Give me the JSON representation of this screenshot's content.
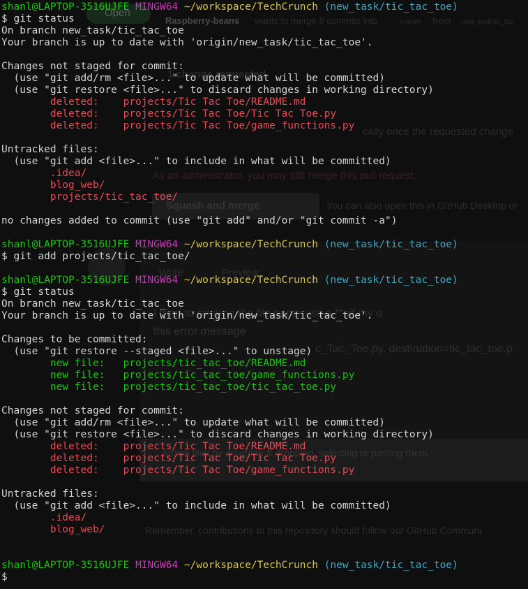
{
  "ghost": {
    "open_label": "Open",
    "repo_user": "Raspberry-beans",
    "merge_text": "wants to merge 8 commits into",
    "base_branch": "master",
    "from_label": "from",
    "head_branch": "new_task/tic_tac",
    "change_requested": "1 change requested",
    "dismiss_hint": "cally once the requested change",
    "admin_note": "As an administrator, you may still merge this pull request.",
    "squash_button": "Squash and merge",
    "desktop_note": "You can also open this in GitHub Desktop or",
    "write_tab": "Write",
    "preview_tab": "Preview",
    "comment_line1": "I tried to rename the file name using **git mv o",
    "comment_line2": "this error message",
    "comment_line3": "c_Tac_Toe.py, destination=tic_tac_toe.p",
    "attach_note": "Attach files by dragging & dropping, selecting or pasting them.",
    "contrib_note": "Remember, contributions to this repository should follow our GitHub Communi"
  },
  "terminal": {
    "lines": [
      [
        {
          "c": "c-prompt-user",
          "t": "shanl@LAPTOP-3516UJFE "
        },
        {
          "c": "c-prompt-sys",
          "t": "MINGW64 "
        },
        {
          "c": "c-prompt-path",
          "t": "~/workspace/TechCrunch "
        },
        {
          "c": "c-prompt-branch",
          "t": "(new_task/tic_tac_toe)"
        }
      ],
      [
        {
          "c": "c-default",
          "t": "$ git status"
        }
      ],
      [
        {
          "c": "c-default",
          "t": "On branch new_task/tic_tac_toe"
        }
      ],
      [
        {
          "c": "c-default",
          "t": "Your branch is up to date with 'origin/new_task/tic_tac_toe'."
        }
      ],
      [
        {
          "c": "c-default",
          "t": ""
        }
      ],
      [
        {
          "c": "c-default",
          "t": "Changes not staged for commit:"
        }
      ],
      [
        {
          "c": "c-default",
          "t": "  (use \"git add/rm <file>...\" to update what will be committed)"
        }
      ],
      [
        {
          "c": "c-default",
          "t": "  (use \"git restore <file>...\" to discard changes in working directory)"
        }
      ],
      [
        {
          "c": "c-red",
          "t": "        deleted:    projects/Tic Tac Toe/README.md"
        }
      ],
      [
        {
          "c": "c-red",
          "t": "        deleted:    projects/Tic Tac Toe/Tic Tac Toe.py"
        }
      ],
      [
        {
          "c": "c-red",
          "t": "        deleted:    projects/Tic Tac Toe/game_functions.py"
        }
      ],
      [
        {
          "c": "c-default",
          "t": ""
        }
      ],
      [
        {
          "c": "c-default",
          "t": "Untracked files:"
        }
      ],
      [
        {
          "c": "c-default",
          "t": "  (use \"git add <file>...\" to include in what will be committed)"
        }
      ],
      [
        {
          "c": "c-red",
          "t": "        .idea/"
        }
      ],
      [
        {
          "c": "c-red",
          "t": "        blog_web/"
        }
      ],
      [
        {
          "c": "c-red",
          "t": "        projects/tic_tac_toe/"
        }
      ],
      [
        {
          "c": "c-default",
          "t": ""
        }
      ],
      [
        {
          "c": "c-default",
          "t": "no changes added to commit (use \"git add\" and/or \"git commit -a\")"
        }
      ],
      [
        {
          "c": "c-default",
          "t": ""
        }
      ],
      [
        {
          "c": "c-prompt-user",
          "t": "shanl@LAPTOP-3516UJFE "
        },
        {
          "c": "c-prompt-sys",
          "t": "MINGW64 "
        },
        {
          "c": "c-prompt-path",
          "t": "~/workspace/TechCrunch "
        },
        {
          "c": "c-prompt-branch",
          "t": "(new_task/tic_tac_toe)"
        }
      ],
      [
        {
          "c": "c-default",
          "t": "$ git add projects/tic_tac_toe/"
        }
      ],
      [
        {
          "c": "c-default",
          "t": ""
        }
      ],
      [
        {
          "c": "c-prompt-user",
          "t": "shanl@LAPTOP-3516UJFE "
        },
        {
          "c": "c-prompt-sys",
          "t": "MINGW64 "
        },
        {
          "c": "c-prompt-path",
          "t": "~/workspace/TechCrunch "
        },
        {
          "c": "c-prompt-branch",
          "t": "(new_task/tic_tac_toe)"
        }
      ],
      [
        {
          "c": "c-default",
          "t": "$ git status"
        }
      ],
      [
        {
          "c": "c-default",
          "t": "On branch new_task/tic_tac_toe"
        }
      ],
      [
        {
          "c": "c-default",
          "t": "Your branch is up to date with 'origin/new_task/tic_tac_toe'."
        }
      ],
      [
        {
          "c": "c-default",
          "t": ""
        }
      ],
      [
        {
          "c": "c-default",
          "t": "Changes to be committed:"
        }
      ],
      [
        {
          "c": "c-default",
          "t": "  (use \"git restore --staged <file>...\" to unstage)"
        }
      ],
      [
        {
          "c": "c-green",
          "t": "        new file:   projects/tic_tac_toe/README.md"
        }
      ],
      [
        {
          "c": "c-green",
          "t": "        new file:   projects/tic_tac_toe/game_functions.py"
        }
      ],
      [
        {
          "c": "c-green",
          "t": "        new file:   projects/tic_tac_toe/tic_tac_toe.py"
        }
      ],
      [
        {
          "c": "c-default",
          "t": ""
        }
      ],
      [
        {
          "c": "c-default",
          "t": "Changes not staged for commit:"
        }
      ],
      [
        {
          "c": "c-default",
          "t": "  (use \"git add/rm <file>...\" to update what will be committed)"
        }
      ],
      [
        {
          "c": "c-default",
          "t": "  (use \"git restore <file>...\" to discard changes in working directory)"
        }
      ],
      [
        {
          "c": "c-red",
          "t": "        deleted:    projects/Tic Tac Toe/README.md"
        }
      ],
      [
        {
          "c": "c-red",
          "t": "        deleted:    projects/Tic Tac Toe/Tic Tac Toe.py"
        }
      ],
      [
        {
          "c": "c-red",
          "t": "        deleted:    projects/Tic Tac Toe/game_functions.py"
        }
      ],
      [
        {
          "c": "c-default",
          "t": ""
        }
      ],
      [
        {
          "c": "c-default",
          "t": "Untracked files:"
        }
      ],
      [
        {
          "c": "c-default",
          "t": "  (use \"git add <file>...\" to include in what will be committed)"
        }
      ],
      [
        {
          "c": "c-red",
          "t": "        .idea/"
        }
      ],
      [
        {
          "c": "c-red",
          "t": "        blog_web/"
        }
      ],
      [
        {
          "c": "c-default",
          "t": ""
        }
      ],
      [
        {
          "c": "c-default",
          "t": ""
        }
      ],
      [
        {
          "c": "c-prompt-user",
          "t": "shanl@LAPTOP-3516UJFE "
        },
        {
          "c": "c-prompt-sys",
          "t": "MINGW64 "
        },
        {
          "c": "c-prompt-path",
          "t": "~/workspace/TechCrunch "
        },
        {
          "c": "c-prompt-branch",
          "t": "(new_task/tic_tac_toe)"
        }
      ],
      [
        {
          "c": "c-default",
          "t": "$"
        }
      ]
    ]
  }
}
